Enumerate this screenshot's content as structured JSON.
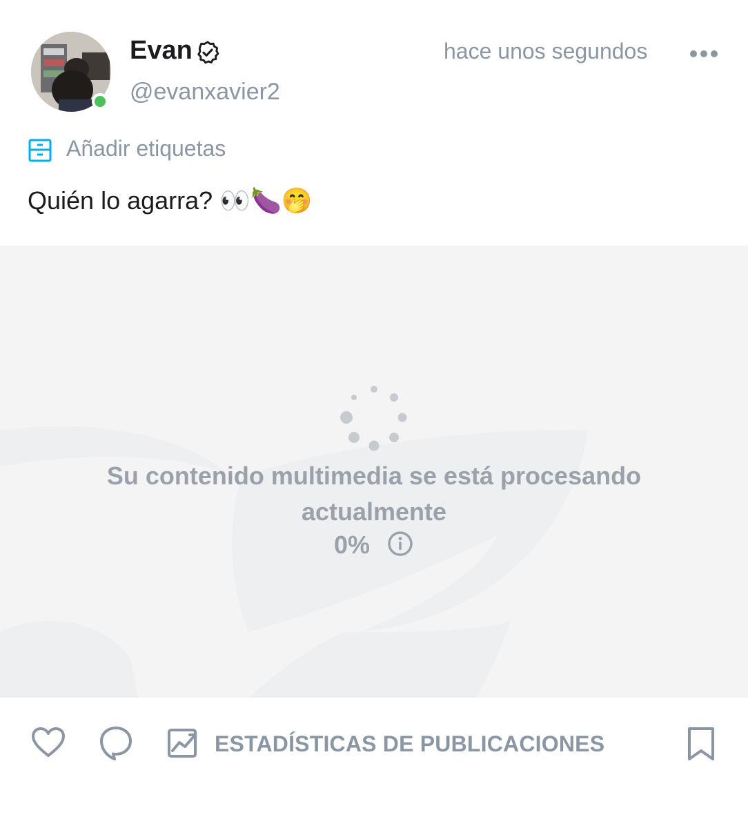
{
  "author": {
    "display_name": "Evan",
    "username": "@evanxavier2",
    "verified": true,
    "online": true,
    "status_color": "#4cc05a"
  },
  "post": {
    "timestamp": "hace unos segundos",
    "add_tags_label": "Añadir etiquetas",
    "text": "Quién lo agarra? 👀🍆🤭"
  },
  "media": {
    "processing_message": "Su contenido multimedia se está procesando actualmente",
    "progress": "0%"
  },
  "actions": {
    "stats_label": "ESTADÍSTICAS DE PUBLICACIONES"
  },
  "icons": {
    "verified": "verified-badge-icon",
    "more": "more-dots-icon",
    "tags": "tag-icon",
    "spinner": "loading-spinner-icon",
    "info": "info-icon",
    "like": "heart-icon",
    "comment": "comment-icon",
    "stats": "stats-chart-icon",
    "bookmark": "bookmark-icon"
  },
  "colors": {
    "accent": "#00aff0",
    "muted_text": "#8a96a3",
    "media_text": "#9aa1ab",
    "media_bg": "#f4f4f5"
  }
}
